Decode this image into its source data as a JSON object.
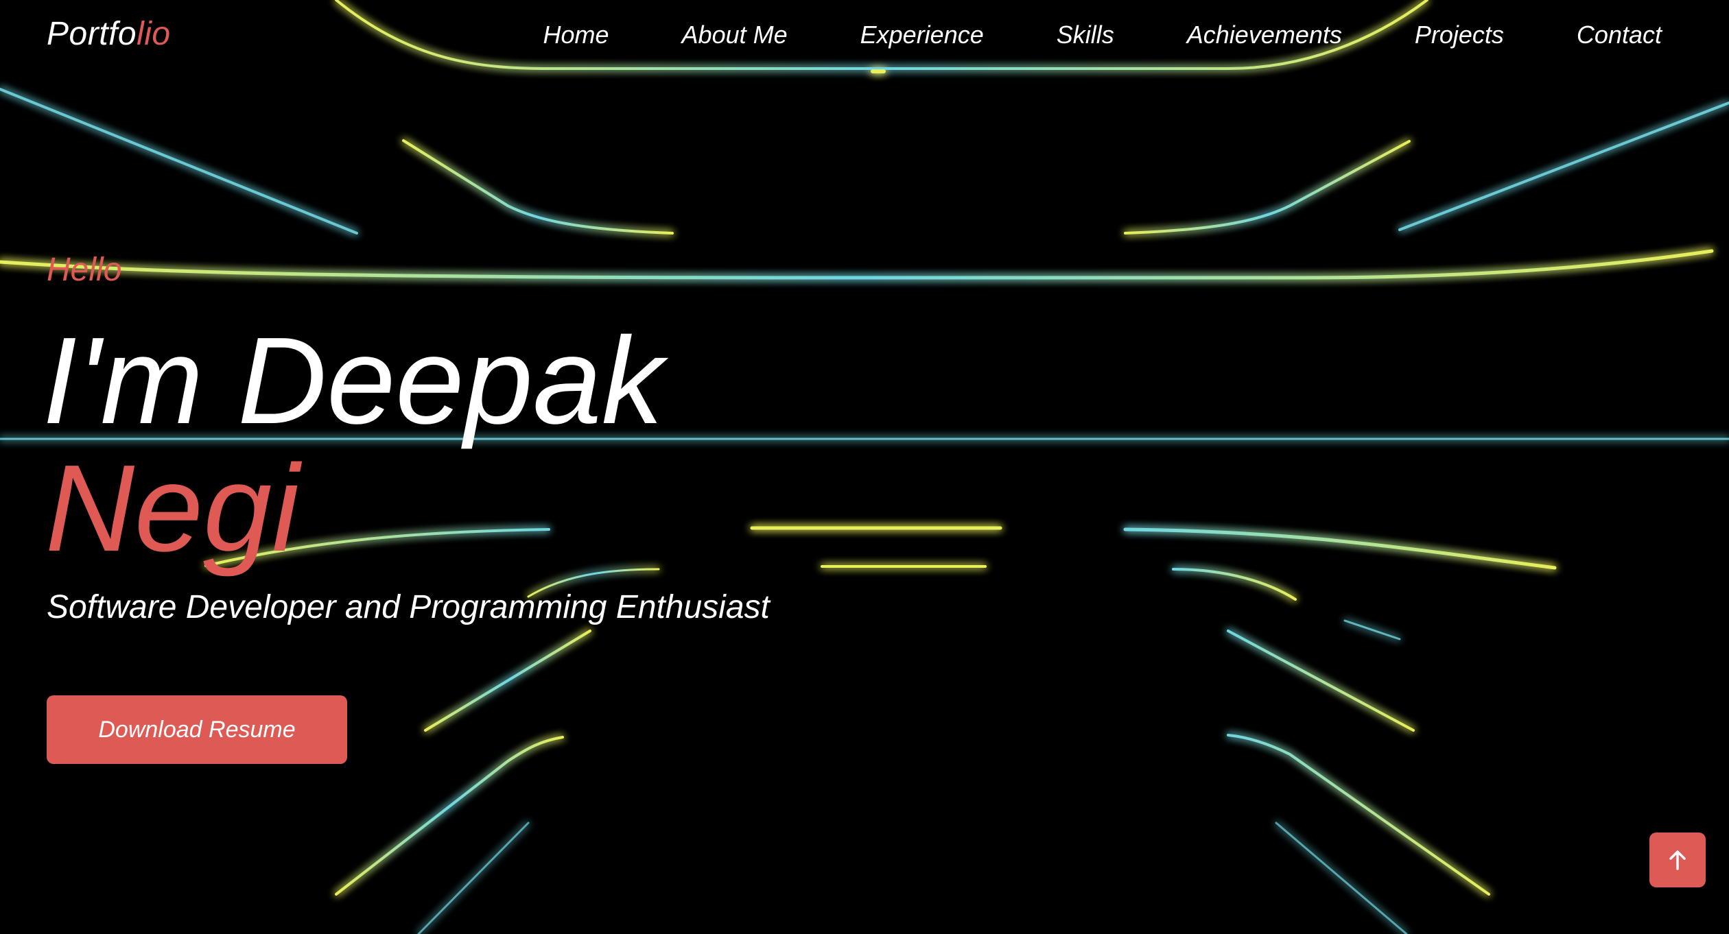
{
  "header": {
    "logo_main": "Portfo",
    "logo_accent": "lio",
    "nav": [
      {
        "label": "Home"
      },
      {
        "label": "About Me"
      },
      {
        "label": "Experience"
      },
      {
        "label": "Skills"
      },
      {
        "label": "Achievements"
      },
      {
        "label": "Projects"
      },
      {
        "label": "Contact"
      }
    ]
  },
  "hero": {
    "greeting": "Hello",
    "name_first": "I'm Deepak",
    "name_last": "Negi",
    "tagline": "Software Developer and Programming Enthusiast",
    "button_label": "Download Resume"
  },
  "scroll_top": {
    "icon": "arrow-up-icon"
  },
  "colors": {
    "accent": "#dd5a55",
    "background": "#000000",
    "glow_yellow": "#e8ef5a",
    "glow_cyan": "#6fd6e0"
  }
}
